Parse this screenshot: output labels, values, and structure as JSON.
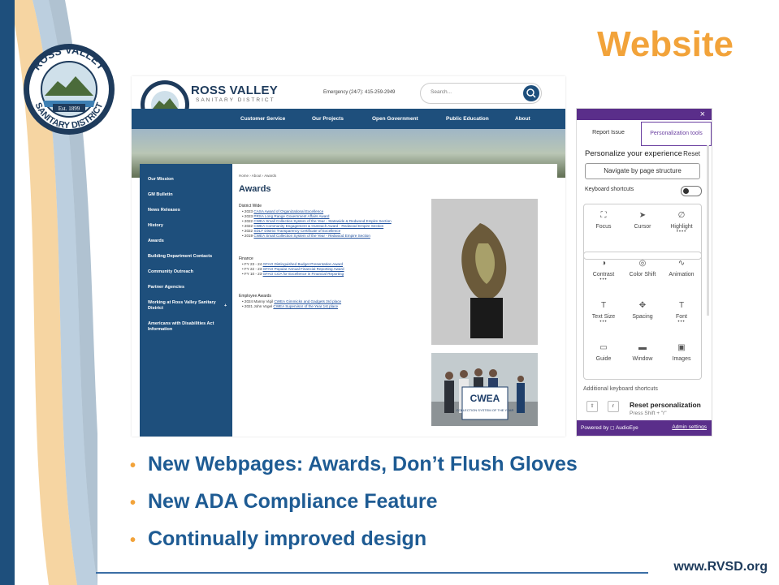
{
  "slide": {
    "title": "Website",
    "url": "www.RVSD.org",
    "bullets": [
      "New Webpages: Awards, Don’t Flush Gloves",
      "New ADA Compliance Feature",
      "Continually improved design"
    ],
    "seal": {
      "text_top": "ROSS VALLEY",
      "text_bottom": "SANITARY DISTRICT",
      "est": "Est. 1899"
    }
  },
  "website": {
    "brand": {
      "name": "ROSS VALLEY",
      "sub": "SANITARY DISTRICT"
    },
    "emergency": "Emergency (24/7): 415-259-2949",
    "search_placeholder": "Search...",
    "nav": [
      "Customer Service",
      "Our Projects",
      "Open Government",
      "Public Education",
      "About"
    ],
    "sidebar": [
      "Our Mission",
      "GM Bulletin",
      "News Releases",
      "History",
      "Awards",
      "Building Department Contacts",
      "Community Outreach",
      "Partner Agencies",
      "Working at Ross Valley Sanitary District",
      "Americans with Disabilities Act Information"
    ],
    "sidebar_plus": "+",
    "breadcrumb": "Home › About › Awards",
    "page_title": "Awards",
    "sections": [
      {
        "heading": "District Wide",
        "items": [
          {
            "year": "2023",
            "link": "CASA Award of Organizational Excellence",
            "suffix": ""
          },
          {
            "year": "2023",
            "link": "PRSA Long Range Government Affairs Award",
            "suffix": ""
          },
          {
            "year": "2022",
            "link": "CWEA Small Collection System of the Year - Statewide & Redwood Empire Section",
            "suffix": ""
          },
          {
            "year": "2022",
            "link": "CWEA Community Engagement & Outreach Award - Redwood Empire Section",
            "suffix": ""
          },
          {
            "year": "2022",
            "link": "SDLF District Transparency Certificate of Excellence",
            "suffix": ""
          },
          {
            "year": "2019",
            "link": "CWEA Small Collection System of the Year - Redwood Empire Section",
            "suffix": ""
          }
        ]
      },
      {
        "heading": "Finance",
        "items": [
          {
            "year": "FY 23 - 24",
            "link": "GFAO Distinguished Budget Presentation Award",
            "suffix": ""
          },
          {
            "year": "FY 22 - 23",
            "link": "GFAO Popular Annual Financial Reporting Award",
            "suffix": ""
          },
          {
            "year": "FY 10 - 23",
            "link": "GFAO COA for Excellence in Financial Reporting",
            "suffix": ""
          }
        ]
      },
      {
        "heading": "Employee Awards",
        "items": [
          {
            "year": "2024 Manny Vigil",
            "link": "CWEA Gimmicks and Gadgets 3rd place",
            "suffix": ""
          },
          {
            "year": "2021 John Vogel",
            "link": "CWEA Supervisor of the Year 1st place",
            "suffix": ""
          }
        ]
      }
    ],
    "banner_text": "CWEA",
    "banner_sub": "COLLECTION SYSTEM OF THE YEAR"
  },
  "panel": {
    "close": "×",
    "tabs": [
      "Report Issue",
      "Personalization tools"
    ],
    "heading": "Personalize your experience",
    "reset": "Reset",
    "navigate_button": "Navigate by page structure",
    "keyboard_shortcuts": "Keyboard shortcuts",
    "tools_row1": [
      {
        "icon": "⛶",
        "label": "Focus",
        "dots": false
      },
      {
        "icon": "➤",
        "label": "Cursor",
        "dots": false
      },
      {
        "icon": "∅",
        "label": "Highlight",
        "dots": true
      }
    ],
    "tools_rest": [
      {
        "icon": "◑",
        "label": "Contrast",
        "dots": true
      },
      {
        "icon": "◎",
        "label": "Color Shift",
        "dots": false
      },
      {
        "icon": "∿",
        "label": "Animation",
        "dots": false
      },
      {
        "icon": "T",
        "label": "Text Size",
        "dots": true
      },
      {
        "icon": "✥",
        "label": "Spacing",
        "dots": false
      },
      {
        "icon": "T",
        "label": "Font",
        "dots": true
      },
      {
        "icon": "▭",
        "label": "Guide",
        "dots": false
      },
      {
        "icon": "▬",
        "label": "Window",
        "dots": false
      },
      {
        "icon": "▣",
        "label": "Images",
        "dots": false
      }
    ],
    "additional": "Additional keyboard shortcuts",
    "keys": [
      "⇧",
      "r"
    ],
    "reset_personalization": "Reset personalization",
    "shortcut_hint": "Press Shift + \"r\"",
    "powered_by": "Powered by ◻ AudioEye",
    "admin": "Admin settings"
  }
}
